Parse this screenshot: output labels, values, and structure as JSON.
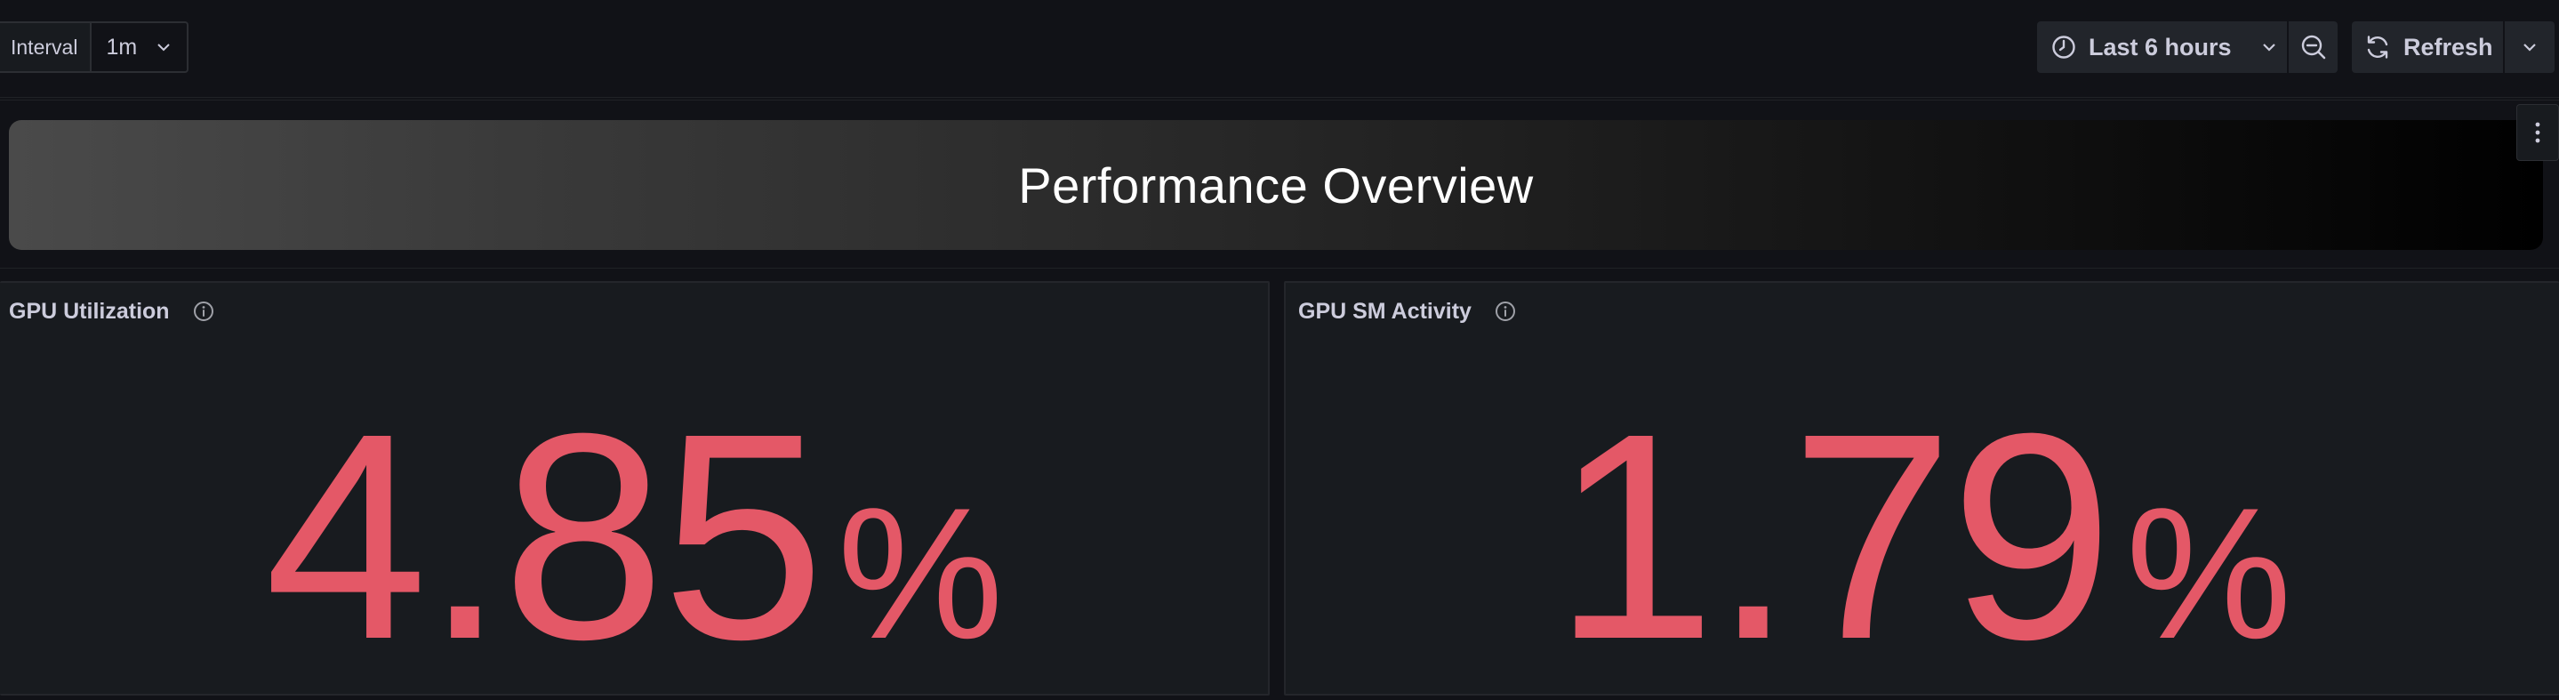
{
  "toolbar": {
    "interval_label": "Interval",
    "interval_value": "1m",
    "time_range_label": "Last 6 hours",
    "refresh_label": "Refresh"
  },
  "icons": {
    "chevron": "chevron-down-icon",
    "clock": "clock-icon",
    "zoom_out": "zoom-out-icon",
    "refresh": "refresh-icon",
    "info": "info-circle-icon",
    "menu": "kebab-menu-icon"
  },
  "text_panel": {
    "title": "Performance Overview"
  },
  "panels": [
    {
      "title": "GPU Utilization",
      "value": "4.85",
      "unit": "%"
    },
    {
      "title": "GPU SM Activity",
      "value": "1.79",
      "unit": "%"
    }
  ],
  "colors": {
    "background": "#111217",
    "panel_bg": "#181b1f",
    "stat_value": "#e45867",
    "text": "#ccccdc"
  }
}
